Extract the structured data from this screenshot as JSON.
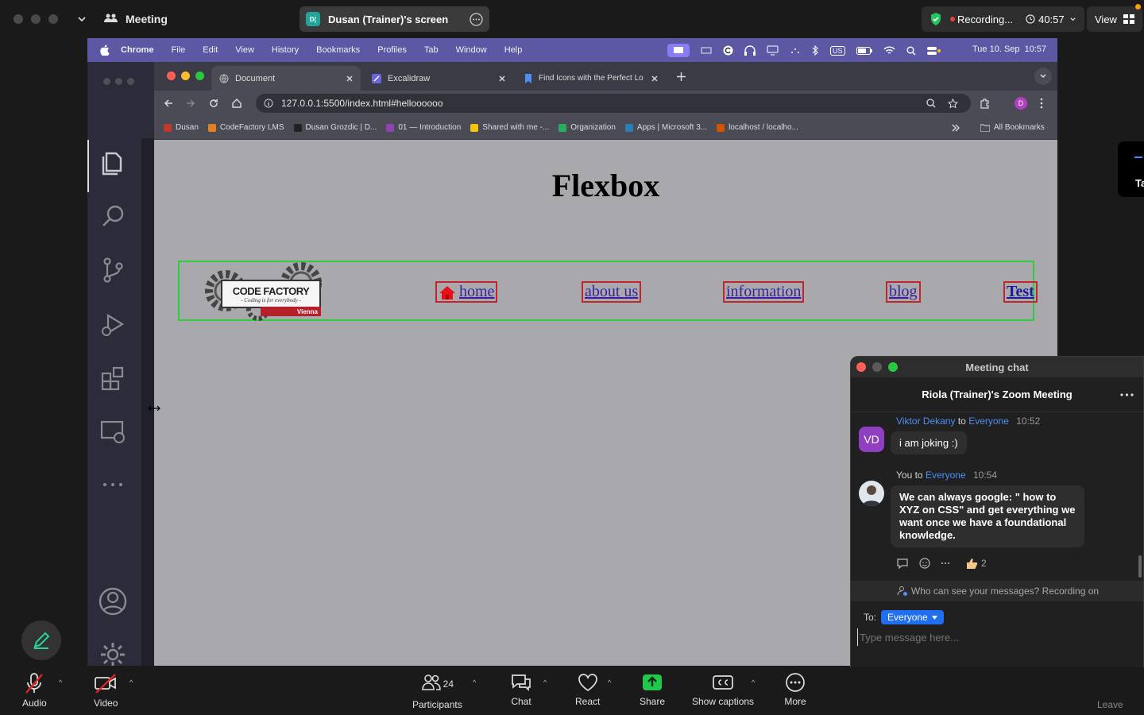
{
  "zoom": {
    "title": "Meeting",
    "share_badge": "D(",
    "share_title": "Dusan (Trainer)'s screen",
    "recording_label": "Recording...",
    "timer": "40:57",
    "view_label": "View",
    "side_label": "Ta"
  },
  "mac_menubar": {
    "items": [
      "Chrome",
      "File",
      "Edit",
      "View",
      "History",
      "Bookmarks",
      "Profiles",
      "Tab",
      "Window",
      "Help"
    ],
    "kbd": "US",
    "datetime": "Tue 10. Sep  10:57"
  },
  "vscode": {
    "problems_count": "0"
  },
  "chrome": {
    "tabs": [
      {
        "label": "Document",
        "active": true
      },
      {
        "label": "Excalidraw",
        "active": false
      },
      {
        "label": "Find Icons with the Perfect Lo",
        "active": false
      }
    ],
    "url": "127.0.0.1:5500/index.html#helloooooo",
    "profile_initial": "D",
    "bookmarks": [
      "Dusan",
      "CodeFactory LMS",
      "Dusan Grozdic | D...",
      "01 — Introduction",
      "Shared with me -...",
      "Organization",
      "Apps | Microsoft 3...",
      "localhost / localho..."
    ],
    "bookmark_colors": [
      "#c0392b",
      "#e67e22",
      "#222222",
      "#8e44ad",
      "#f1c40f",
      "#27ae60",
      "#2980b9",
      "#d35400"
    ],
    "all_bookmarks": "All Bookmarks"
  },
  "webpage": {
    "title": "Flexbox",
    "logo_title": "CODE FACTORY",
    "logo_tagline": "- Coding is for everybody -",
    "logo_city": "Vienna",
    "nav_links": [
      "home",
      "about us",
      "information",
      "blog",
      "Test"
    ]
  },
  "chat": {
    "window_title": "Meeting chat",
    "meeting_name": "Riola (Trainer)'s Zoom Meeting",
    "messages": [
      {
        "initials": "VD",
        "sender": "Viktor Dekany",
        "to_word": "to",
        "recipient": "Everyone",
        "time": "10:52",
        "text": "i am joking :)"
      },
      {
        "sender": "You",
        "to_word": "to",
        "recipient": "Everyone",
        "time": "10:54",
        "text": "We can always google: \" how to XYZ on CSS\" and get everything we want once we have a foundational knowledge.",
        "reaction_count": "2"
      }
    ],
    "visibility_note": "Who can see your messages? Recording on",
    "to_label": "To:",
    "to_value": "Everyone",
    "placeholder": "Type message here..."
  },
  "bottombar": {
    "audio": "Audio",
    "video": "Video",
    "participants": "Participants",
    "participant_count": "24",
    "chat": "Chat",
    "react": "React",
    "share": "Share",
    "captions": "Show captions",
    "more": "More",
    "leave": "Leave"
  },
  "colors": {
    "accent_blue": "#4f8ef7",
    "share_green": "#1fca4b",
    "nav_border_green": "#2ecc40",
    "link_border_red": "#c0272d",
    "mac_menubar": "#5c58a4"
  }
}
